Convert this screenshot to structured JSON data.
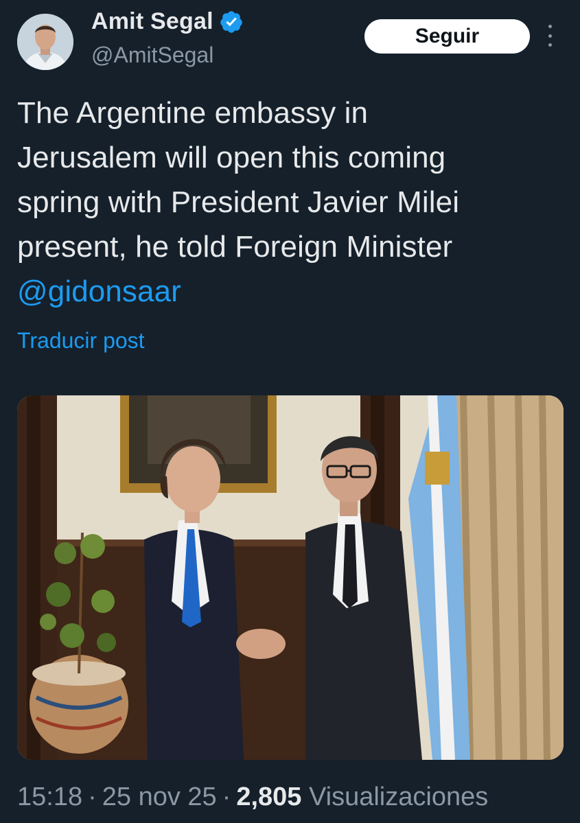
{
  "author": {
    "name": "Amit Segal",
    "handle": "@AmitSegal",
    "verified": true
  },
  "follow_label": "Seguir",
  "more_icon": "more-vertical-icon",
  "tweet": {
    "lines": [
      "The Argentine embassy in",
      "Jerusalem will open this coming",
      "spring with President Javier Milei",
      "present, he told Foreign Minister"
    ],
    "mention": "@gidonsaar"
  },
  "translate_label": "Traducir post",
  "meta": {
    "time": "15:18",
    "date": "25 nov 25",
    "views_count": "2,805",
    "views_label": "Visualizaciones"
  },
  "colors": {
    "background": "#15202b",
    "accent": "#1d9bf0",
    "muted": "#8b98a5",
    "text": "#e7e9ea"
  }
}
